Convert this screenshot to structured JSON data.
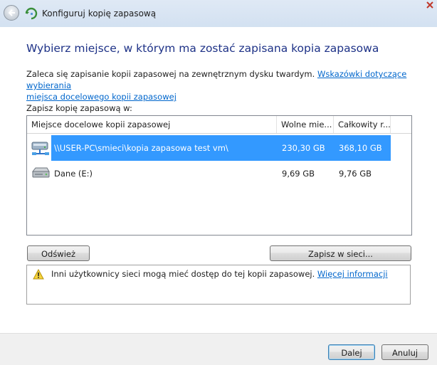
{
  "window": {
    "title": "Konfiguruj kopię zapasową"
  },
  "heading": "Wybierz miejsce, w którym ma zostać zapisana kopia zapasowa",
  "intro": {
    "text": "Zaleca się zapisanie kopii zapasowej na zewnętrznym dysku twardym. ",
    "link_part1": "Wskazówki dotyczące wybierania",
    "link_part2": "miejsca docelowego kopii zapasowej"
  },
  "save_to_label": "Zapisz kopię zapasową w:",
  "table": {
    "columns": [
      "Miejsce docelowe kopii zapasowej",
      "Wolne mie...",
      "Całkowity r..."
    ],
    "rows": [
      {
        "name": "\\\\USER-PC\\smieci\\kopia zapasowa test vm\\",
        "free": "230,30 GB",
        "total": "368,10 GB",
        "icon": "network-drive-icon",
        "selected": true
      },
      {
        "name": "Dane (E:)",
        "free": "9,69 GB",
        "total": "9,76 GB",
        "icon": "hard-drive-icon",
        "selected": false
      }
    ]
  },
  "buttons": {
    "refresh": "Odśwież",
    "save_on_network": "Zapisz w sieci...",
    "next": "Dalej",
    "cancel": "Anuluj"
  },
  "warning": {
    "text": "Inni użytkownicy sieci mogą mieć dostęp do tej kopii zapasowej. ",
    "link": "Więcej informacji",
    "icon": "warning-icon"
  },
  "colors": {
    "selection": "#3399ff",
    "heading": "#1e3287",
    "link": "#0066cc"
  }
}
